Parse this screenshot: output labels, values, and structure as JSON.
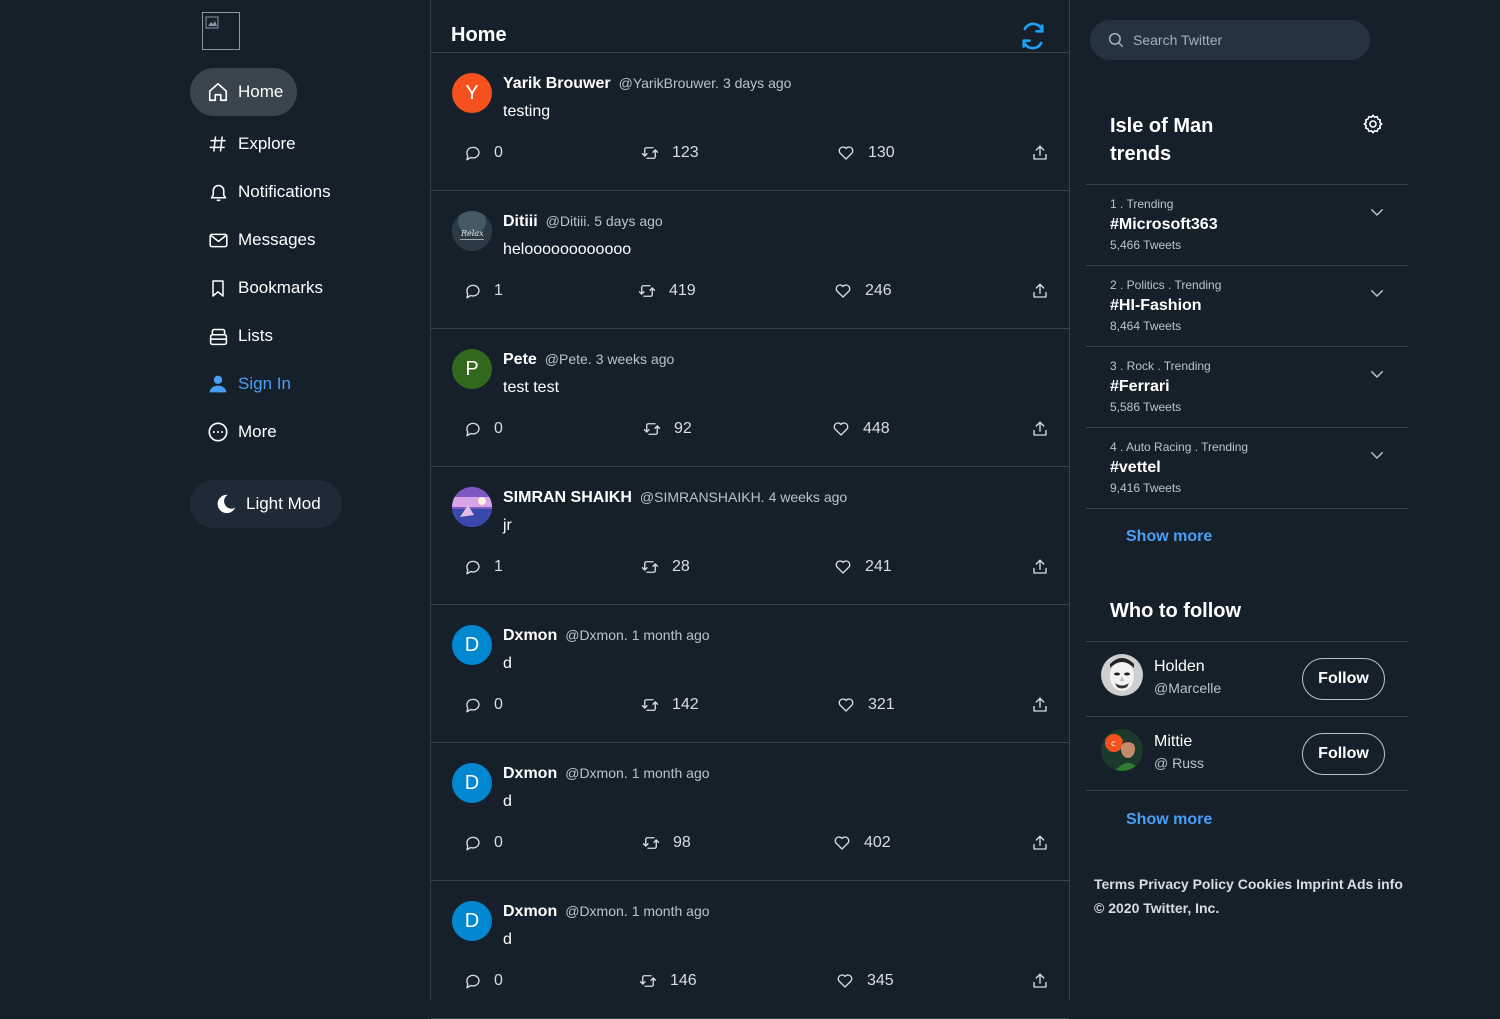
{
  "sidebar": {
    "logo_icon": "broken-image-icon",
    "items": [
      {
        "label": "Home",
        "icon": "home-icon"
      },
      {
        "label": "Explore",
        "icon": "hashtag-icon"
      },
      {
        "label": "Notifications",
        "icon": "bell-icon"
      },
      {
        "label": "Messages",
        "icon": "mail-icon"
      },
      {
        "label": "Bookmarks",
        "icon": "bookmark-icon"
      },
      {
        "label": "Lists",
        "icon": "lists-icon"
      },
      {
        "label": "Sign In",
        "icon": "user-icon"
      },
      {
        "label": "More",
        "icon": "more-icon"
      }
    ],
    "light_mode_label": "Light Mod"
  },
  "feed": {
    "title": "Home",
    "tweets": [
      {
        "initial": "Y",
        "avatar_color": "#f4511e",
        "name": "Yarik Brouwer",
        "handle": "@YarikBrouwer.",
        "time": "3 days ago",
        "text": "testing",
        "replies": "0",
        "retweets": "123",
        "likes": "130"
      },
      {
        "initial": "",
        "avatar_color": "#2b3a44",
        "name": "Ditiii",
        "handle": "@Ditiii.",
        "time": "5 days ago",
        "text": "heloooooooooooo",
        "replies": "1",
        "retweets": "419",
        "likes": "246"
      },
      {
        "initial": "P",
        "avatar_color": "#33691e",
        "name": "Pete",
        "handle": "@Pete.",
        "time": "3 weeks ago",
        "text": "test test",
        "replies": "0",
        "retweets": "92",
        "likes": "448"
      },
      {
        "initial": "",
        "avatar_color": "#6a5acd",
        "name": "SIMRAN SHAIKH",
        "handle": "@SIMRANSHAIKH.",
        "time": "4 weeks ago",
        "text": "jr",
        "replies": "1",
        "retweets": "28",
        "likes": "241"
      },
      {
        "initial": "D",
        "avatar_color": "#0288d1",
        "name": "Dxmon",
        "handle": "@Dxmon.",
        "time": "1 month ago",
        "text": "d",
        "replies": "0",
        "retweets": "142",
        "likes": "321"
      },
      {
        "initial": "D",
        "avatar_color": "#0288d1",
        "name": "Dxmon",
        "handle": "@Dxmon.",
        "time": "1 month ago",
        "text": "d",
        "replies": "0",
        "retweets": "98",
        "likes": "402"
      },
      {
        "initial": "D",
        "avatar_color": "#0288d1",
        "name": "Dxmon",
        "handle": "@Dxmon.",
        "time": "1 month ago",
        "text": "d",
        "replies": "0",
        "retweets": "146",
        "likes": "345"
      }
    ]
  },
  "right": {
    "search_placeholder": "Search Twitter",
    "trends_title": "Isle of Man trends",
    "trends": [
      {
        "meta": "1 . Trending",
        "tag": "#Microsoft363",
        "count": "5,466 Tweets"
      },
      {
        "meta": "2 . Politics . Trending",
        "tag": "#HI-Fashion",
        "count": "8,464 Tweets"
      },
      {
        "meta": "3 . Rock . Trending",
        "tag": "#Ferrari",
        "count": "5,586 Tweets"
      },
      {
        "meta": "4 . Auto Racing . Trending",
        "tag": "#vettel",
        "count": "9,416 Tweets"
      }
    ],
    "show_more": "Show more",
    "who_to_follow_title": "Who to follow",
    "follow": [
      {
        "name": "Holden",
        "handle": "@Marcelle",
        "button": "Follow"
      },
      {
        "name": "Mittie",
        "handle": "@ Russ",
        "button": "Follow"
      }
    ],
    "show_more_follow": "Show more",
    "footer_links": "Terms Privacy Policy Cookies Imprint Ads info",
    "copyright": "© 2020 Twitter, Inc."
  },
  "colors": {
    "background": "#15202b",
    "accent": "#1da1f2",
    "link": "#4a9ff5",
    "border": "#38444d"
  }
}
